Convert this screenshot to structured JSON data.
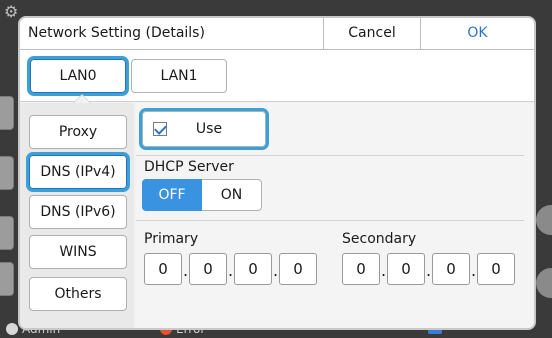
{
  "dialog": {
    "title": "Network Setting (Details)",
    "cancel_label": "Cancel",
    "ok_label": "OK"
  },
  "tabs": [
    {
      "label": "LAN0",
      "selected": true
    },
    {
      "label": "LAN1",
      "selected": false
    }
  ],
  "sidebar": {
    "items": [
      {
        "label": "Proxy",
        "selected": false
      },
      {
        "label": "DNS (IPv4)",
        "selected": true
      },
      {
        "label": "DNS (IPv6)",
        "selected": false
      },
      {
        "label": "WINS",
        "selected": false
      },
      {
        "label": "Others",
        "selected": false
      }
    ]
  },
  "dns": {
    "use_label": "Use",
    "use_checked": true,
    "dhcp_label": "DHCP Server",
    "dhcp_off_label": "OFF",
    "dhcp_on_label": "ON",
    "dhcp_value": "OFF",
    "primary_label": "Primary",
    "primary_octets": [
      "0",
      "0",
      "0",
      "0"
    ],
    "secondary_label": "Secondary",
    "secondary_octets": [
      "0",
      "0",
      "0",
      "0"
    ]
  },
  "background": {
    "user_label": "Admin",
    "error_label": "Error"
  },
  "colors": {
    "accent": "#3a93e0",
    "focus_outline": "#3aa0d8",
    "ok_text": "#2a75c9"
  }
}
